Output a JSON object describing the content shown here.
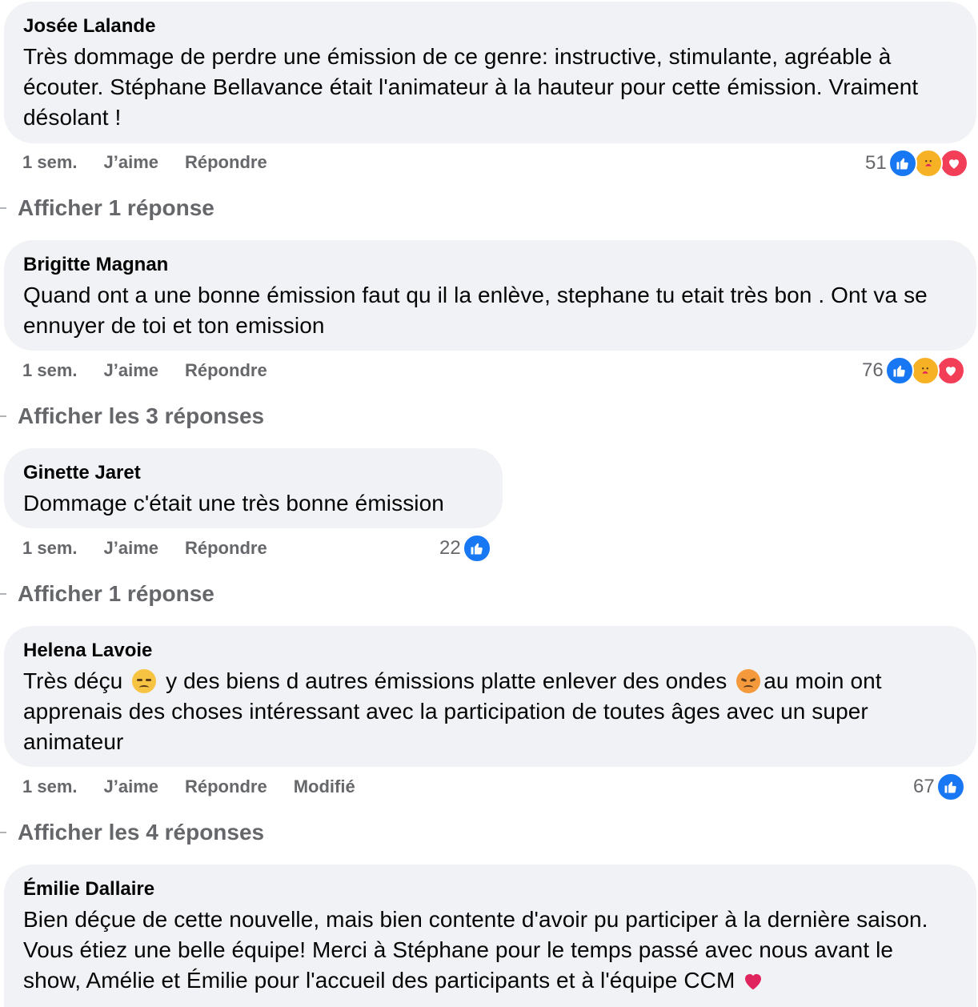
{
  "comments": [
    {
      "author": "Josée Lalande",
      "text": "Très dommage de perdre une émission de ce genre: instructive, stimulante, agréable à écouter. Stéphane Bellavance était l'animateur à la hauteur pour cette émission. Vraiment désolant !",
      "time": "1 sem.",
      "like_label": "J’aime",
      "reply_label": "Répondre",
      "reaction_count": "51",
      "reactions": [
        "like-icon",
        "care-icon",
        "love-icon"
      ],
      "replies_label": "Afficher 1 réponse"
    },
    {
      "author": "Brigitte Magnan",
      "text": "Quand ont a une bonne émission faut qu il la enlève, stephane tu etait très bon . Ont va se ennuyer de toi et ton emission",
      "time": "1 sem.",
      "like_label": "J’aime",
      "reply_label": "Répondre",
      "reaction_count": "76",
      "reactions": [
        "like-icon",
        "care-icon",
        "love-icon"
      ],
      "replies_label": "Afficher les 3 réponses"
    },
    {
      "author": "Ginette Jaret",
      "text": "Dommage c'était une très bonne émission",
      "time": "1 sem.",
      "like_label": "J’aime",
      "reply_label": "Répondre",
      "reaction_count": "22",
      "reactions": [
        "like-icon"
      ],
      "replies_label": "Afficher 1 réponse"
    },
    {
      "author": "Helena Lavoie",
      "text_part1": "Très déçu",
      "text_part2": " y des biens d autres émissions platte enlever des ondes ",
      "text_part3": "au moin ont apprenais des choses intéressant avec la participation de toutes âges avec un super animateur",
      "emojis": [
        "disappointed-face-emoji",
        "pouting-face-emoji"
      ],
      "time": "1 sem.",
      "like_label": "J’aime",
      "reply_label": "Répondre",
      "edited_label": "Modifié",
      "reaction_count": "67",
      "reactions": [
        "like-icon"
      ],
      "replies_label": "Afficher les 4 réponses"
    },
    {
      "author": "Émilie Dallaire",
      "text": "Bien déçue de cette nouvelle, mais bien contente d'avoir pu participer à la dernière saison. Vous étiez une belle équipe! Merci à Stéphane pour le temps passé avec nous avant le show, Amélie et Émilie pour l'accueil des participants et à l'équipe CCM",
      "trailing_emoji": "red-heart-emoji"
    }
  ],
  "colors": {
    "bubble": "#f0f2f5",
    "secondary_text": "#65676b",
    "like": "#1877f2",
    "care": "#f7b125",
    "love": "#f33e58"
  }
}
